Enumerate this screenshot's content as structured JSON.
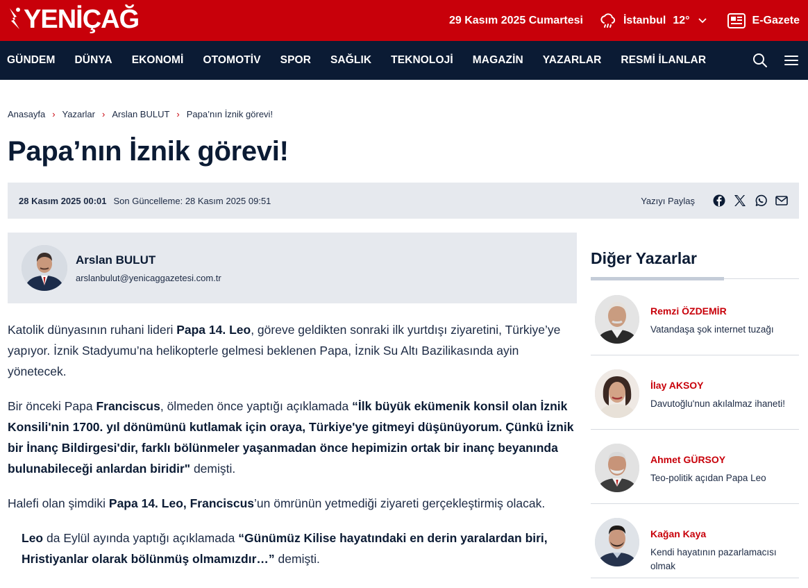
{
  "header": {
    "logo": "YENİÇAĞ",
    "date": "29 Kasım 2025 Cumartesi",
    "weather": {
      "city": "İstanbul",
      "temp": "12°",
      "icon": "cloud-rain-icon"
    },
    "egazete": "E-Gazete"
  },
  "nav": {
    "items": [
      "GÜNDEM",
      "DÜNYA",
      "EKONOMİ",
      "OTOMOTİV",
      "SPOR",
      "SAĞLIK",
      "TEKNOLOJİ",
      "MAGAZİN",
      "YAZARLAR",
      "RESMİ İLANLAR"
    ]
  },
  "breadcrumb": [
    "Anasayfa",
    "Yazarlar",
    "Arslan BULUT",
    "Papa’nın İznik görevi!"
  ],
  "article": {
    "title": "Papa’nın İznik görevi!",
    "published": "28 Kasım 2025 00:01",
    "updated": "Son Güncelleme: 28 Kasım 2025 09:51",
    "share_label": "Yazıyı Paylaş",
    "author": {
      "name": "Arslan BULUT",
      "email": "arslanbulut@yenicaggazetesi.com.tr"
    },
    "p1": {
      "a": "Katolik dünyasının ruhani lideri ",
      "b": "Papa 14. Leo",
      "c": ", göreve geldikten sonraki ilk yurtdışı ziyaretini, Türkiye’ye yapıyor. İznik Stadyumu’na helikopterle gelmesi beklenen Papa, İznik Su Altı Bazilikasında ayin yönetecek."
    },
    "p2": {
      "a": "Bir önceki Papa ",
      "b": "Franciscus",
      "c": ", ölmeden önce yaptığı açıklamada ",
      "d": "“İlk büyük ekümenik konsil olan İznik Konsili'nin 1700. yıl dönümünü kutlamak için oraya, Türkiye'ye gitmeyi düşünüyorum. Çünkü İznik bir İnanç Bildirgesi'dir, farklı bölünmeler yaşanmadan önce hepimizin ortak bir inanç beyanında bulunabileceği anlardan biridir\"",
      "e": " demişti."
    },
    "p3": {
      "a": "Halefi olan şimdiki ",
      "b": "Papa 14. Leo, Franciscus",
      "c": "’un ömrünün yetmediği ziyareti gerçekleştirmiş olacak."
    },
    "p4": {
      "a": "Leo",
      "b": " da Eylül ayında yaptığı açıklamada ",
      "c": "“Günümüz Kilise hayatındaki en derin yaralardan biri, Hristiyanlar olarak bölünmüş olmamızdır…”",
      "d": " demişti."
    }
  },
  "sidebar": {
    "title": "Diğer Yazarlar",
    "writers": [
      {
        "name": "Remzi ÖZDEMİR",
        "text": "Vatandaşa şok internet tuzağı"
      },
      {
        "name": "İlay AKSOY",
        "text": "Davutoğlu'nun akılalmaz ihaneti!"
      },
      {
        "name": "Ahmet GÜRSOY",
        "text": "Teo-politik açıdan Papa Leo"
      },
      {
        "name": "Kağan Kaya",
        "text": "Kendi hayatının pazarlamacısı olmak"
      }
    ]
  },
  "colors": {
    "brand_red": "#c8000a",
    "navy": "#0b1b34",
    "panel": "#e6e9ee"
  }
}
